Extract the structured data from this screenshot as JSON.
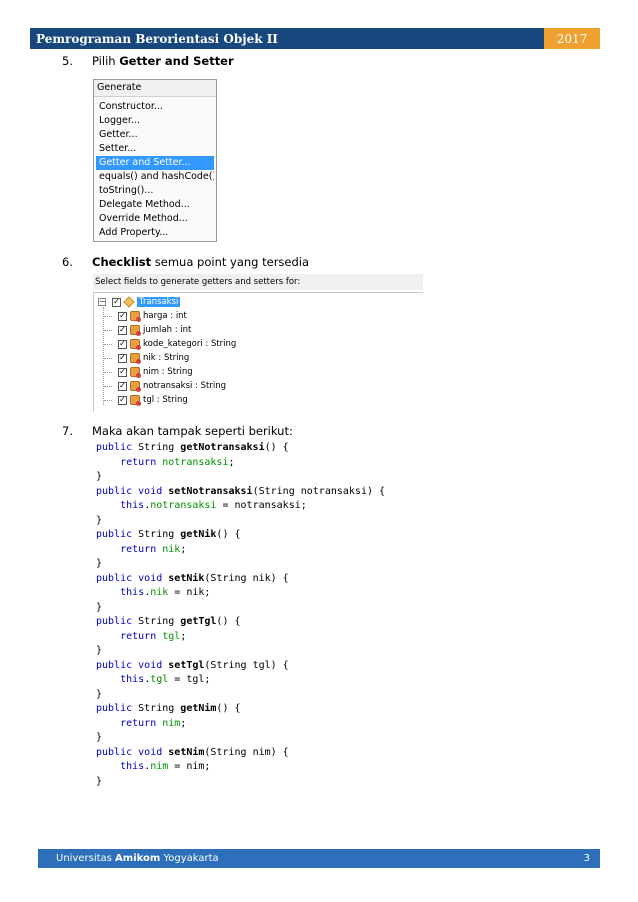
{
  "header": {
    "title": "Pemrograman Berorientasi Objek II",
    "year": "2017"
  },
  "steps": [
    {
      "num": "5.",
      "pre": "Pilih ",
      "bold": "Getter and Setter",
      "post": ""
    },
    {
      "num": "6.",
      "pre": "",
      "bold": "Checklist",
      "post": " semua point yang tersedia"
    },
    {
      "num": "7.",
      "pre": "Maka akan tampak seperti berikut:",
      "bold": "",
      "post": ""
    }
  ],
  "generate_menu": {
    "title": "Generate",
    "items": [
      "Constructor...",
      "Logger...",
      "Getter...",
      "Setter...",
      "Getter and Setter...",
      "equals() and hashCode()...",
      "toString()...",
      "Delegate Method...",
      "Override Method...",
      "Add Property..."
    ],
    "selected": "Getter and Setter..."
  },
  "fields_dialog": {
    "prompt": "Select fields to generate getters and setters for:",
    "root": "Transaksi",
    "fields": [
      "harga : int",
      "jumlah : int",
      "kode_kategori : String",
      "nik : String",
      "nim : String",
      "notransaksi : String",
      "tgl : String"
    ],
    "check_mark": "✓",
    "expander": "−"
  },
  "code": {
    "kw_public": "public",
    "kw_string": "String",
    "kw_void": "void",
    "kw_return": "return",
    "kw_this": "this",
    "methods": [
      {
        "name": "getNotransaksi",
        "field": "notransaksi",
        "type": "get"
      },
      {
        "name": "setNotransaksi",
        "field": "notransaksi",
        "type": "set"
      },
      {
        "name": "getNik",
        "field": "nik",
        "type": "get"
      },
      {
        "name": "setNik",
        "field": "nik",
        "type": "set"
      },
      {
        "name": "getTgl",
        "field": "tgl",
        "type": "get"
      },
      {
        "name": "setTgl",
        "field": "tgl",
        "type": "set"
      },
      {
        "name": "getNim",
        "field": "nim",
        "type": "get"
      },
      {
        "name": "setNim",
        "field": "nim",
        "type": "set"
      }
    ]
  },
  "footer": {
    "pre": "Universitas ",
    "bold": "Amikom",
    "post": " Yogyakarta",
    "page": "3"
  },
  "colors": {
    "header_bg": "#17477d",
    "year_bg": "#f0a030",
    "footer_bg": "#2d6fba",
    "selection": "#3399ff",
    "keyword": "#0000c0",
    "field": "#009000"
  }
}
